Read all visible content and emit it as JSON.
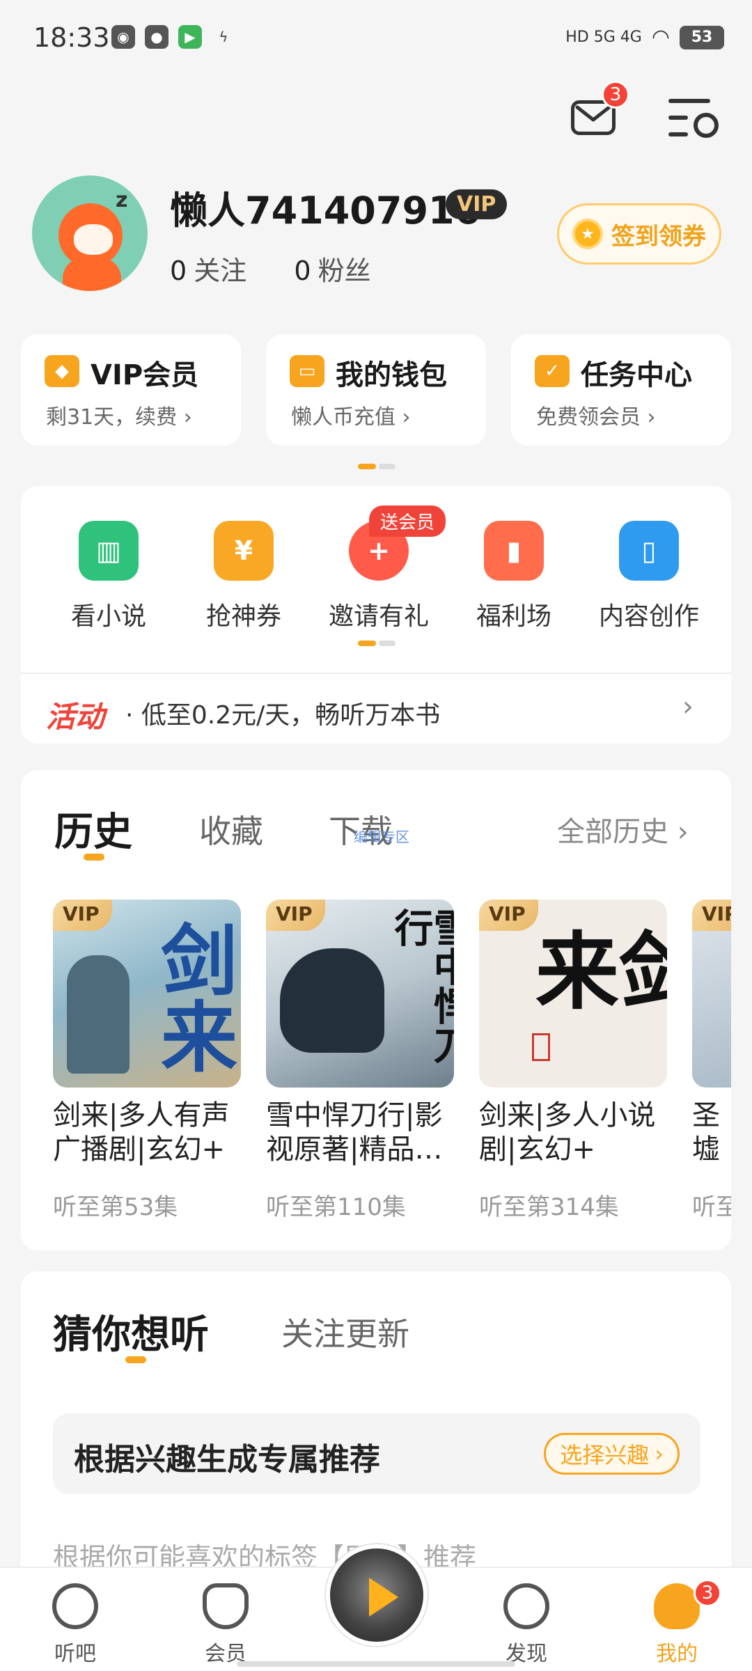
{
  "status_bar": {
    "time": "18:33",
    "network": "HD 5G 4G",
    "battery": "53"
  },
  "header": {
    "mail_badge": "3"
  },
  "profile": {
    "username": "懒人741407916",
    "vip_tag": "VIP",
    "following_count": "0",
    "following_label": "关注",
    "fans_count": "0",
    "fans_label": "粉丝",
    "checkin_label": "签到领券"
  },
  "quick_cards": [
    {
      "title": "VIP会员",
      "subtitle": "剩31天，续费 ›",
      "icon": "vip-diamond-icon"
    },
    {
      "title": "我的钱包",
      "subtitle": "懒人币充值 ›",
      "icon": "wallet-icon"
    },
    {
      "title": "任务中心",
      "subtitle": "免费领会员 ›",
      "icon": "task-calendar-icon"
    }
  ],
  "functions": [
    {
      "label": "看小说",
      "icon": "book-icon",
      "color": "#2fc27c"
    },
    {
      "label": "抢神券",
      "icon": "coupon-icon",
      "color": "#f9a825"
    },
    {
      "label": "邀请有礼",
      "icon": "invite-icon",
      "color": "#ff5a4a"
    },
    {
      "label": "福利场",
      "icon": "gift-box-icon",
      "color": "#ff6d4d"
    },
    {
      "label": "内容创作",
      "icon": "creator-screen-icon",
      "color": "#2e9bf0"
    }
  ],
  "gift_tag": "送会员",
  "activity": {
    "logo": "活动",
    "text": "· 低至0.2元/天，畅听万本书"
  },
  "history": {
    "tabs": [
      "历史",
      "收藏",
      "下载"
    ],
    "all_label": "全部历史 ›",
    "overlay_text": "编辑专区",
    "books": [
      {
        "title": "剑来|多人有声广播剧|玄幻+",
        "progress": "听至第53集",
        "vip": "VIP",
        "cover_text": "剑来"
      },
      {
        "title": "雪中悍刀行|影视原著|精品…",
        "progress": "听至第110集",
        "vip": "VIP",
        "cover_text": "雪中悍刀行"
      },
      {
        "title": "剑来|多人小说剧|玄幻+",
        "progress": "听至第314集",
        "vip": "VIP",
        "cover_text": "剑来"
      },
      {
        "title": "圣墟作|",
        "progress": "听至",
        "vip": "VIP",
        "cover_text": ""
      }
    ]
  },
  "guess": {
    "title": "猜你想听",
    "tab": "关注更新",
    "rec_text": "根据兴趣生成专属推荐",
    "rec_button": "选择兴趣",
    "faded_line": "根据你可能喜欢的标签【原著】推荐"
  },
  "bottom_nav": {
    "items": [
      {
        "label": "听吧",
        "icon": "listen-disc-icon"
      },
      {
        "label": "会员",
        "icon": "member-heart-icon"
      },
      {
        "label": "发现",
        "icon": "discover-planet-icon"
      },
      {
        "label": "我的",
        "icon": "profile-mascot-icon"
      }
    ],
    "profile_badge": "3"
  }
}
